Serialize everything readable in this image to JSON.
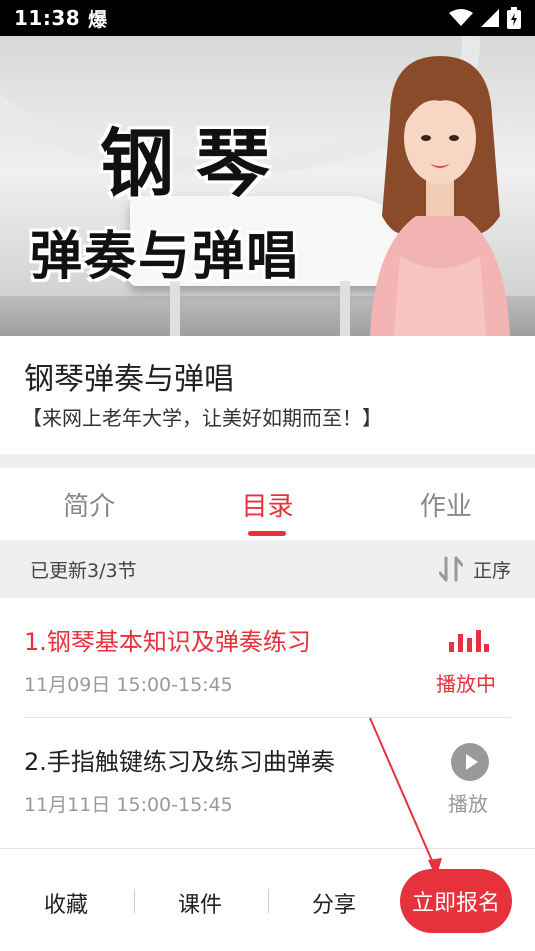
{
  "status_bar": {
    "time": "11:38",
    "left_icon": "爆"
  },
  "banner": {
    "title_line1": "钢琴",
    "title_line2": "弹奏与弹唱"
  },
  "course": {
    "title": "钢琴弹奏与弹唱",
    "subtitle": "【来网上老年大学，让美好如期而至！】"
  },
  "tabs": [
    {
      "label": "简介",
      "active": false
    },
    {
      "label": "目录",
      "active": true
    },
    {
      "label": "作业",
      "active": false
    }
  ],
  "catalog": {
    "update_text": "已更新3/3节",
    "sort_label": "正序"
  },
  "lessons": [
    {
      "title": "1.钢琴基本知识及弹奏练习",
      "time": "11月09日 15:00-15:45",
      "status": "播放中"
    },
    {
      "title": "2.手指触键练习及练习曲弹奏",
      "time": "11月11日 15:00-15:45",
      "status": "播放"
    }
  ],
  "bottom_bar": {
    "collect": "收藏",
    "courseware": "课件",
    "share": "分享",
    "enroll": "立即报名"
  },
  "colors": {
    "accent": "#e5323c",
    "background_gray": "#efefef"
  }
}
